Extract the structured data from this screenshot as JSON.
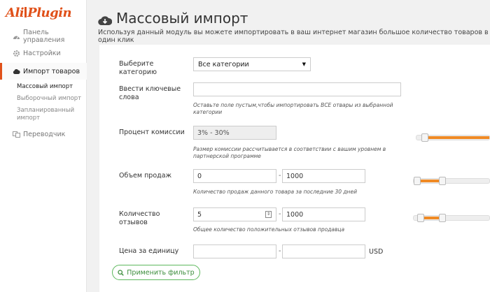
{
  "logo": {
    "part1": "Ali",
    "part2": "Plugin"
  },
  "sidebar": {
    "items": [
      {
        "label": "Панель управления",
        "icon": "dashboard-icon"
      },
      {
        "label": "Настройки",
        "icon": "gear-icon"
      },
      {
        "label": "Импорт товаров",
        "icon": "cloud-icon"
      },
      {
        "label": "Переводчик",
        "icon": "translate-icon"
      }
    ],
    "subitems": [
      {
        "label": "Массовый импорт"
      },
      {
        "label": "Выборочный импорт"
      },
      {
        "label": "Запланированный импорт"
      }
    ]
  },
  "header": {
    "title": "Массовый импорт",
    "description": "Используя данный модуль вы можете импортировать в ваш интернет магазин большое количество товаров в один клик"
  },
  "form": {
    "category": {
      "label": "Выберите категорию",
      "value": "Все категории"
    },
    "keywords": {
      "label": "Ввести ключевые слова",
      "value": "",
      "hint": "Оставьте поле пустым,чтобы импортировать ВСЕ отвары из выбранной категории"
    },
    "commission": {
      "label": "Процент комиссии",
      "value": "3% - 30%",
      "hint": "Размер комиссии рассчитывается в соответствии с вашим уровнем в партнерской программе",
      "range": [
        0.07,
        1.0
      ]
    },
    "sales": {
      "label": "Объем продаж",
      "min": "0",
      "max": "1000",
      "hint": "Количество продаж данного товара за последние 30 дней",
      "range": [
        0.0,
        0.33
      ]
    },
    "reviews": {
      "label": "Количество отзывов",
      "min": "5",
      "max": "1000",
      "hint": "Общее количество положительных отзывов продавца",
      "range": [
        0.05,
        0.33
      ]
    },
    "price": {
      "label": "Цена за единицу",
      "min": "",
      "max": "",
      "unit": "USD"
    },
    "dash": "-"
  },
  "apply_button": {
    "label": "Применить фильтр",
    "icon": "search-icon"
  }
}
